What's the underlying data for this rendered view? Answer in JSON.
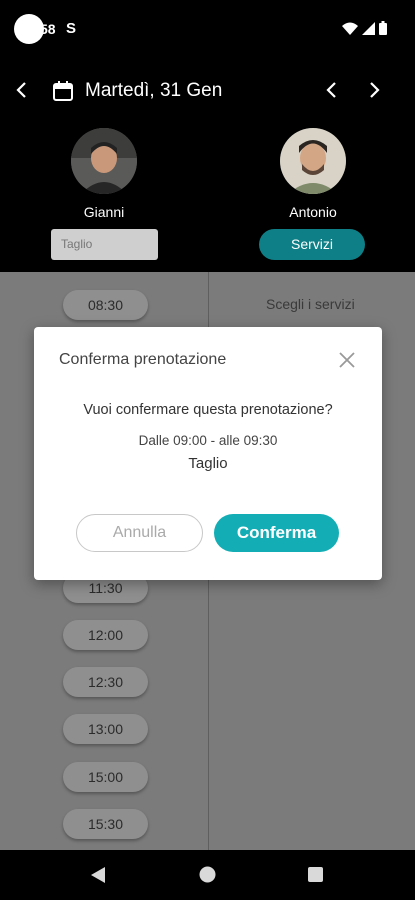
{
  "status_bar": {
    "time": "58",
    "notification_icon": "S"
  },
  "header": {
    "date": "Martedì, 31 Gen"
  },
  "staff": [
    {
      "name": "Gianni",
      "selector_value": "Taglio"
    },
    {
      "name": "Antonio",
      "button_label": "Servizi"
    }
  ],
  "time_slots": [
    "08:30",
    "11:30",
    "12:00",
    "12:30",
    "13:00",
    "15:00",
    "15:30"
  ],
  "services_hint": "Scegli i servizi",
  "modal": {
    "title": "Conferma prenotazione",
    "question": "Vuoi confermare questa prenotazione?",
    "time_range": "Dalle 09:00 - alle 09:30",
    "service": "Taglio",
    "cancel_label": "Annulla",
    "confirm_label": "Conferma"
  },
  "colors": {
    "accent": "#13aeb5",
    "accent_dark": "#0e7f86"
  }
}
